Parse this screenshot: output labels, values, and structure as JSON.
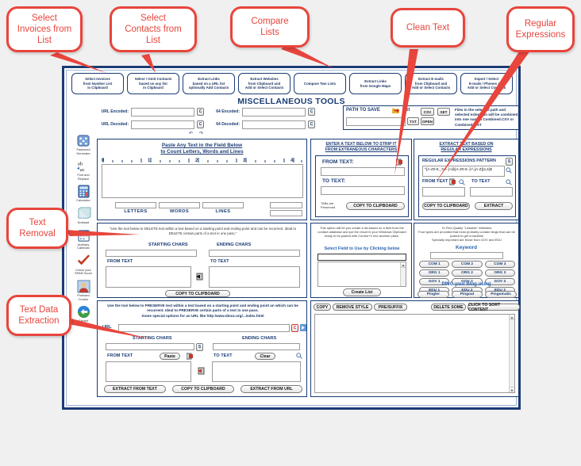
{
  "annotations": [
    {
      "id": "a1",
      "text": "Select\nInvoices from\nList"
    },
    {
      "id": "a2",
      "text": "Select\nContacts from\nList"
    },
    {
      "id": "a3",
      "text": "Compare\nLists"
    },
    {
      "id": "a4",
      "text": "Clean Text"
    },
    {
      "id": "a5",
      "text": "Regular\nExpressions"
    },
    {
      "id": "a6",
      "text": "Text\nRemoval"
    },
    {
      "id": "a7",
      "text": "Text Data\nExtraction"
    }
  ],
  "app": {
    "title": "MISCELLANEOUS TOOLS",
    "toolbar": [
      {
        "label": "Select Invoices\nfrom Number List\nin Clipboard"
      },
      {
        "label": "Select / Omit Contacts\nbased on any list\nin Clipboard"
      },
      {
        "label": "Extract Links\nbased on a URL list\noptionally Add Contacts"
      },
      {
        "label": "Extract Websites\nfrom Clipboard and\nAdd or Select Contacts"
      },
      {
        "label": "Compare Two Lists"
      },
      {
        "label": "Extract Links\nfrom Google Maps"
      },
      {
        "label": "Extract E-mails\nfrom Clipboard and\nAdd or Select Contacts"
      },
      {
        "label": "Import / Select\nE-mails / Phones and\nAdd or Select Contacts"
      }
    ],
    "encoder": {
      "url_encoded_label": "URL Encoded:",
      "url_decoded_label": "URL Decoded:",
      "b64_encoded_label": "64 Encoded:",
      "b64_decoded_label": "64 Decoded:",
      "copy_button": "C",
      "url_encoded_value": "",
      "url_decoded_value": "",
      "b64_encoded_value": "",
      "b64_decoded_value": "",
      "undo_icon": "undo-icon",
      "redo_icon": "redo-icon"
    },
    "path": {
      "label": "PATH TO SAVE",
      "ext_label": "Ext",
      "folder_icon": "folder-arrow-icon",
      "path_value": "",
      "btn_txt": "TXT",
      "btn_csv": "CSV",
      "btn_set": "SET",
      "btn_open": "OPEN",
      "note": "Files in the selected path and selected extension will be combined into one named Combined.CSV or Combined .TXT"
    },
    "sidebar": [
      {
        "icon": "dice-icon",
        "label": "Password\nGenerator"
      },
      {
        "icon": "abac-icon",
        "label": "Find and\nReplace"
      },
      {
        "icon": "calculator-icon",
        "label": "Calculator"
      },
      {
        "icon": "notepad-icon",
        "label": "Notepad"
      },
      {
        "icon": "calendar-icon",
        "label": "Auxiliary\nCalendar"
      },
      {
        "icon": "checkmark-icon",
        "label": "Check your\nSPAM Score"
      },
      {
        "icon": "person-icon",
        "label": "Postcard\nCreator"
      },
      {
        "icon": "extract-icon",
        "label": "Extract\nfrom File"
      }
    ],
    "counter_panel": {
      "title": "Paste Any Text in the Field Below\nto Count Letters, Words and Lines",
      "ruler_ticks": [
        "0",
        "1",
        "2",
        "3",
        "4"
      ],
      "text_value": "",
      "letters_label": "LETTERS",
      "words_label": "WORDS",
      "lines_label": "LINES",
      "letters_value": "",
      "words_value": "",
      "lines_value": ""
    },
    "delete_panel": {
      "note": "\"Use the tool below to DELETE text within a text based on a starting point and ending point and can be recurrent. Ideal to DELETE certain parts of a text in one pass.\"",
      "starting_chars_label": "STARTING CHARS",
      "ending_chars_label": "ENDING CHARS",
      "starting_chars_value": "",
      "ending_chars_value": "",
      "from_text_label": "FROM TEXT",
      "to_text_label": "TO TEXT",
      "from_text_value": "",
      "to_text_value": "",
      "copy_button": "COPY TO CLIPBOARD",
      "transfer_icon": "transfer-left-icon"
    },
    "preserve_panel": {
      "note": "Use the tool below to PRESERVE text within a text based on a starting point and ending point an which can be recurrent. Ideal to PRESERVE certain parts of a text  in one pass.\nSome special options for an URL like http:/www.dmoz.org/...index.html",
      "url_label": "URL",
      "url_value": "",
      "url_copy_button": "C",
      "url_go_icon": "go-icon",
      "starting_chars_label": "STARTING CHARS",
      "ending_chars_label": "ENDING CHARS",
      "starting_chars_value": "",
      "ending_chars_value": "",
      "s_button": "S",
      "from_text_label": "FROM TEXT",
      "to_text_label": "TO TEXT",
      "paste_button": "Paste",
      "clear_button": "Clear",
      "from_text_value": "",
      "to_text_value": "",
      "extract_from_text_button": "EXTRACT FROM TEXT",
      "copy_button": "COPY TO CLIPBOARD",
      "extract_from_url_button": "EXTRACT FROM URL",
      "transfer_icon": "transfer-left-icon",
      "paste_icon": "paste-red-icon",
      "search_icon": "search-icon"
    },
    "clean_panel": {
      "title": "ENTER A TEXT BELOW TO STRIP IT\nFROM EXTRANEOUS CHARACTERS",
      "from_text_label": "FROM TEXT:",
      "to_text_label": "TO TEXT:",
      "from_text_value": "",
      "to_text_value": "",
      "tabs_note": "TABs are\nPreserved",
      "copy_button": "COPY TO CLIPBOARD",
      "paste_icon": "paste-red-icon"
    },
    "regex_panel": {
      "title": "EXTRACT TEXT BASED ON\nREGULAR EXPRESSIONS",
      "pattern_label": "REGULAR EXPRESSIONS PATTERN",
      "s_button": "S",
      "pattern_value": "^[A-Z0-9._%+-]+@[A-Z0-9.-]+\\.[A-Z]{2,4}$",
      "from_text_label": "FROM TEXT",
      "to_text_label": "TO TEXT",
      "from_text_value": "",
      "to_text_value": "",
      "copy_button": "COPY TO CLIPBOARD",
      "extract_button": "EXTRACT",
      "paste_icon": "paste-red-icon",
      "search_icon": "search-icon"
    },
    "list_panel": {
      "note": "This option will let you create a list based on a field from the contact database and put the result in your Windows Clipboard ready to be pasted with Control+V into another place.",
      "select_note": "Select Field to Use by Clicking below",
      "selected_value": "",
      "create_button": "Create List"
    },
    "seo_panel": {
      "note": "To Find Quality \"Linkable\" Websites\nFour types are provided that most probably contain blogs that can be posted to get a backlink\nSpecially important are those from GOV and EDU",
      "keyword_label": "Keyword",
      "keyword_value": "",
      "buttons": [
        "COM 1",
        "COM 2",
        "COM 3",
        "ORG 1",
        "ORG 2",
        "ORG 3",
        "GOV 1",
        "GOV 2",
        "GOV 3",
        "EDU 1",
        "EDU 2",
        "EDU 3"
      ],
      "ping_label": "PING your Blog using",
      "ping_buttons": [
        "Pingler",
        "Pingoat",
        "Pingomatic"
      ]
    },
    "sort_panel": {
      "buttons_left": [
        "COPY",
        "REMOVE STYLE",
        "PRE/SUFFIX"
      ],
      "buttons_right": [
        "DELETE SOME",
        "CLICK TO SORT CONTENT"
      ],
      "content_value": ""
    }
  },
  "colors": {
    "accent": "#1b3c75",
    "callout": "#e8453c",
    "window_border": "#1b3c75",
    "background": "#f0f0f0"
  }
}
